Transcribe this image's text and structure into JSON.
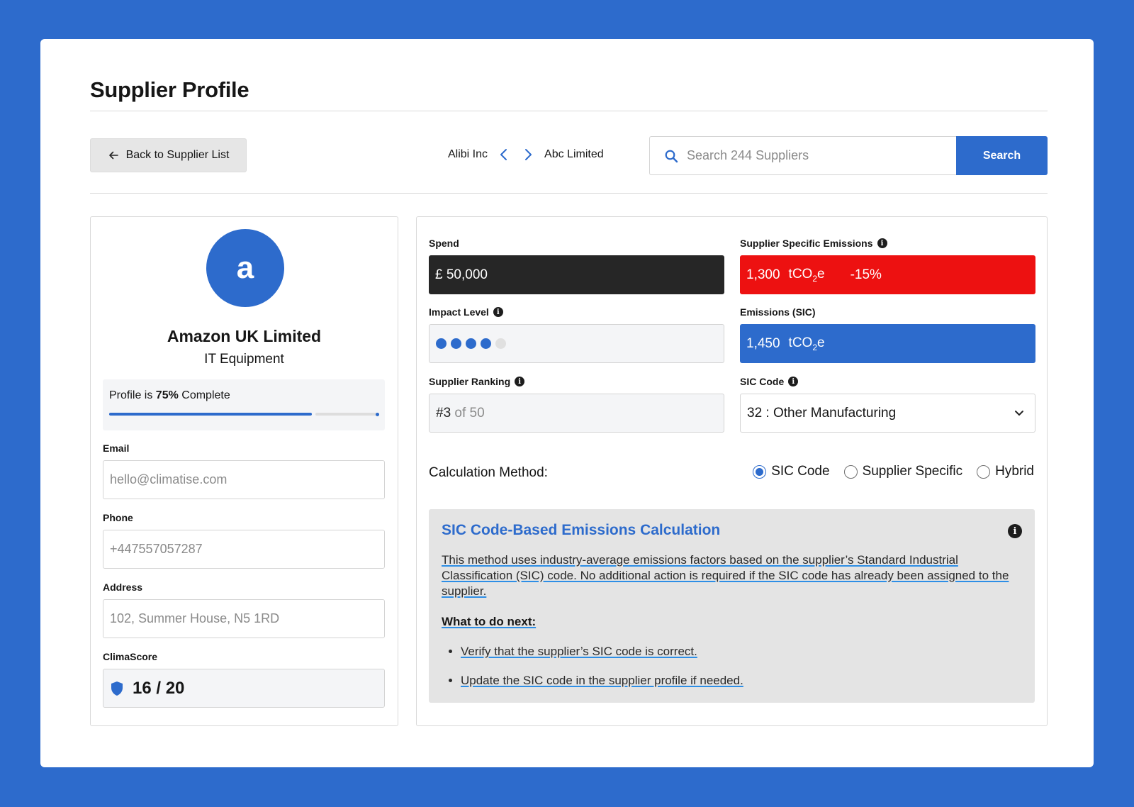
{
  "page": {
    "title": "Supplier Profile"
  },
  "toolbar": {
    "back_label": "Back to Supplier List",
    "prev_supplier": "Alibi Inc",
    "next_supplier": "Abc Limited",
    "search_placeholder": "Search 244 Suppliers",
    "search_button": "Search"
  },
  "profile": {
    "avatar_letter": "a",
    "name": "Amazon UK Limited",
    "category": "IT Equipment",
    "completion_prefix": "Profile is ",
    "completion_value": "75%",
    "completion_suffix": " Complete",
    "completion_fraction": 0.75,
    "email_label": "Email",
    "email_placeholder": "hello@climatise.com",
    "phone_label": "Phone",
    "phone_placeholder": "+447557057287",
    "address_label": "Address",
    "address_placeholder": "102, Summer House, N5 1RD",
    "climascore_label": "ClimaScore",
    "climascore_value": "16 / 20"
  },
  "metrics": {
    "spend_label": "Spend",
    "spend_value": "£ 50,000",
    "sse_label": "Supplier Specific Emissions",
    "sse_value": "1,300",
    "sse_unit_main": "tCO",
    "sse_unit_sub": "2",
    "sse_unit_end": "e",
    "sse_change": "-15%",
    "impact_label": "Impact Level",
    "impact_level": 4,
    "impact_max": 5,
    "sic_emissions_label": "Emissions (SIC)",
    "sic_emissions_value": "1,450",
    "sic_unit_main": "tCO",
    "sic_unit_sub": "2",
    "sic_unit_end": "e",
    "ranking_label": "Supplier Ranking",
    "ranking_value": "#3",
    "ranking_of": " of 50",
    "sic_code_label": "SIC Code",
    "sic_code_value": "32 : Other Manufacturing"
  },
  "calculation": {
    "label": "Calculation Method:",
    "options": [
      "SIC Code",
      "Supplier Specific",
      "Hybrid"
    ],
    "selected": "SIC Code"
  },
  "info_card": {
    "title": "SIC Code-Based Emissions Calculation",
    "paragraph": "This method uses industry-average emissions factors based on the supplier’s Standard Industrial Classification (SIC) code. No additional action is required if the SIC code has already been assigned to the supplier.",
    "subheading": "What to do next:",
    "steps": [
      "Verify that the supplier’s SIC code is correct.",
      "Update the SIC code in the supplier profile if needed."
    ]
  },
  "colors": {
    "brand_blue": "#2d6bcc",
    "alert_red": "#ed1111",
    "dark": "#262626",
    "dot_inactive": "#e0e0e0"
  },
  "icons": {
    "back": "arrow-left-icon",
    "prev": "chevron-left-icon",
    "next": "chevron-right-icon",
    "search": "search-icon",
    "info": "info-icon",
    "shield": "shield-icon",
    "dropdown": "chevron-down-icon"
  }
}
